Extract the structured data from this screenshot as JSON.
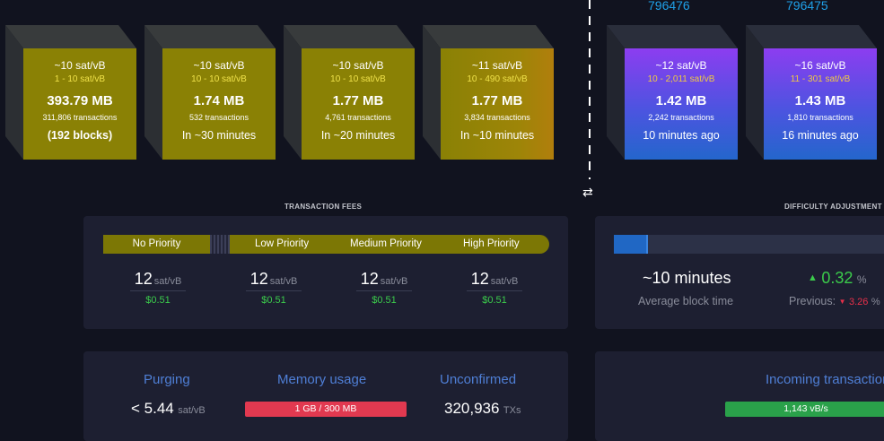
{
  "mempool_blocks": [
    {
      "fee_avg": "~10 sat/vB",
      "fee_range": "1 - 10 sat/vB",
      "size": "393.79 MB",
      "tx": "311,806 transactions",
      "eta": "(192 blocks)"
    },
    {
      "fee_avg": "~10 sat/vB",
      "fee_range": "10 - 10 sat/vB",
      "size": "1.74 MB",
      "tx": "532 transactions",
      "eta": "In ~30 minutes"
    },
    {
      "fee_avg": "~10 sat/vB",
      "fee_range": "10 - 10 sat/vB",
      "size": "1.77 MB",
      "tx": "4,761 transactions",
      "eta": "In ~20 minutes"
    },
    {
      "fee_avg": "~11 sat/vB",
      "fee_range": "10 - 490 sat/vB",
      "size": "1.77 MB",
      "tx": "3,834 transactions",
      "eta": "In ~10 minutes"
    }
  ],
  "mined_blocks": [
    {
      "height": "796476",
      "fee_avg": "~12 sat/vB",
      "fee_range": "10 - 2,011 sat/vB",
      "size": "1.42 MB",
      "tx": "2,242 transactions",
      "ago": "10 minutes ago"
    },
    {
      "height": "796475",
      "fee_avg": "~16 sat/vB",
      "fee_range": "11 - 301 sat/vB",
      "size": "1.43 MB",
      "tx": "1,810 transactions",
      "ago": "16 minutes ago"
    }
  ],
  "swap_icon": "⇄",
  "transaction_fees": {
    "title": "TRANSACTION FEES",
    "bar_labels": {
      "no": "No Priority",
      "low": "Low Priority",
      "medium": "Medium Priority",
      "high": "High Priority"
    },
    "unit": "sat/vB",
    "items": [
      {
        "value": "12",
        "usd": "$0.51"
      },
      {
        "value": "12",
        "usd": "$0.51"
      },
      {
        "value": "12",
        "usd": "$0.51"
      },
      {
        "value": "12",
        "usd": "$0.51"
      }
    ]
  },
  "difficulty": {
    "title": "DIFFICULTY ADJUSTMENT",
    "progress_fraction": 0.12,
    "avg_block_time": "~10 minutes",
    "avg_block_time_label": "Average block time",
    "change": "0.32",
    "change_unit": "%",
    "previous_label": "Previous:",
    "previous_value": "3.26",
    "previous_unit": "%",
    "colors": {
      "up": "#3bcb4b",
      "down": "#e8304a"
    }
  },
  "stats": {
    "purging_title": "Purging",
    "purging_value": "< 5.44",
    "purging_unit": "sat/vB",
    "memory_title": "Memory usage",
    "memory_value": "1 GB / 300 MB",
    "unconfirmed_title": "Unconfirmed",
    "unconfirmed_value": "320,936",
    "unconfirmed_unit": "TXs",
    "incoming_title": "Incoming transactions",
    "incoming_value": "1,143 vB/s"
  }
}
